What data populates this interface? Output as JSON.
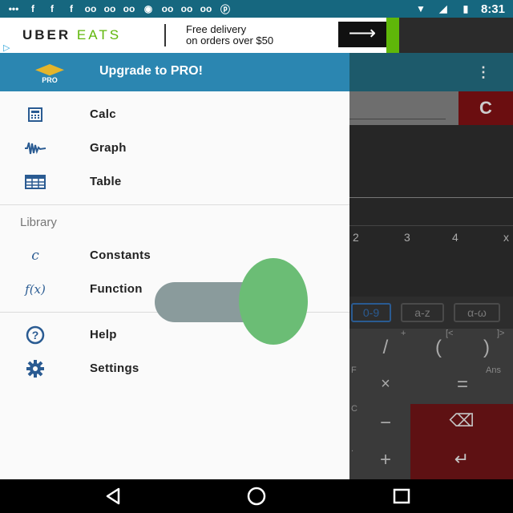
{
  "status_bar": {
    "time": "8:31",
    "notification_icons": [
      "more-icon",
      "facebook-icon",
      "facebook-icon",
      "facebook-icon",
      "voicemail-icon",
      "voicemail-icon",
      "voicemail-icon",
      "beeline-icon",
      "voicemail-icon",
      "voicemail-icon",
      "voicemail-icon",
      "pinterest-icon"
    ],
    "right_icons": [
      "wifi-icon",
      "signal-icon",
      "battery-charging-icon"
    ]
  },
  "ad": {
    "brand_first": "UBER",
    "brand_second": "EATS",
    "line1": "Free delivery",
    "line2": "on orders over $50",
    "arrow": "⟶",
    "adchoices": "▷"
  },
  "drawer": {
    "header": {
      "badge": "PRO",
      "label": "Upgrade to PRO!"
    },
    "items": [
      {
        "label": "Calc",
        "icon": "calculator-icon"
      },
      {
        "label": "Graph",
        "icon": "graph-icon"
      },
      {
        "label": "Table",
        "icon": "table-icon"
      }
    ],
    "library_label": "Library",
    "library_items": [
      {
        "label": "Constants",
        "icon": "constants-icon",
        "glyph": "c"
      },
      {
        "label": "Function",
        "icon": "function-icon",
        "glyph": "f(x)"
      }
    ],
    "bottom_items": [
      {
        "label": "Help",
        "icon": "help-icon"
      },
      {
        "label": "Settings",
        "icon": "settings-icon"
      }
    ]
  },
  "background_app": {
    "menu": "⋮",
    "clear_button": "C",
    "graph_ticks": [
      "2",
      "3",
      "4",
      "x"
    ],
    "tabs": [
      "0-9",
      "a-z",
      "α-ω"
    ],
    "keys": {
      "divide": "/",
      "open_paren": "(",
      "close_paren": ")",
      "times": "×",
      "equals": "=",
      "minus": "−",
      "plus": "+",
      "ans_label": "Ans",
      "lt_label": "[<",
      "gt_label": "]>",
      "plus_small": "+",
      "f_label": "F",
      "c_label": "C",
      "dot_label": "."
    }
  },
  "nav_bar": {
    "back": "◁",
    "home": "○",
    "recents": "□"
  },
  "colors": {
    "status_bar": "#16677f",
    "drawer_header": "#2b86b1",
    "icon_blue": "#2a5b92",
    "overlay_green": "#6bbd75",
    "overlay_gray": "#8a9b9c"
  }
}
